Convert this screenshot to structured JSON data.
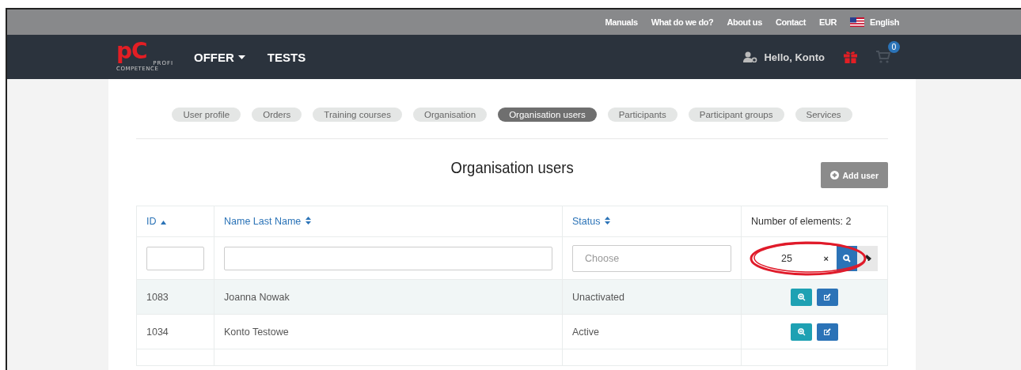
{
  "top_links": [
    "Manuals",
    "What do we do?",
    "About us",
    "Contact",
    "EUR"
  ],
  "language": "English",
  "logo": {
    "mark": "pC",
    "line_1": "PROFI",
    "line_2": "COMPETENCE"
  },
  "nav": [
    {
      "label": "OFFER",
      "dropdown": true
    },
    {
      "label": "TESTS",
      "dropdown": false
    }
  ],
  "greeting": "Hello, Konto",
  "cart_count": "0",
  "tabs": [
    {
      "label": "User profile",
      "selected": false
    },
    {
      "label": "Orders",
      "selected": false
    },
    {
      "label": "Training courses",
      "selected": false
    },
    {
      "label": "Organisation",
      "selected": false
    },
    {
      "label": "Organisation users",
      "selected": true
    },
    {
      "label": "Participants",
      "selected": false
    },
    {
      "label": "Participant groups",
      "selected": false
    },
    {
      "label": "Services",
      "selected": false
    }
  ],
  "heading": "Organisation users",
  "add_button": "Add user",
  "table": {
    "columns": [
      {
        "label": "ID",
        "sorted": true
      },
      {
        "label": "Name Last Name",
        "sorted": false
      },
      {
        "label": "Status",
        "sorted": false
      }
    ],
    "count_label": "Number of elements: 2",
    "filters": {
      "status_placeholder": "Choose",
      "page_size": "25",
      "clear_mark": "×"
    },
    "rows": [
      {
        "id": "1083",
        "name": "Joanna Nowak",
        "status": "Unactivated",
        "highlighted": true
      },
      {
        "id": "1034",
        "name": "Konto Testowe",
        "status": "Active",
        "highlighted": false
      }
    ]
  },
  "annotation": {
    "kind": "ellipse"
  }
}
